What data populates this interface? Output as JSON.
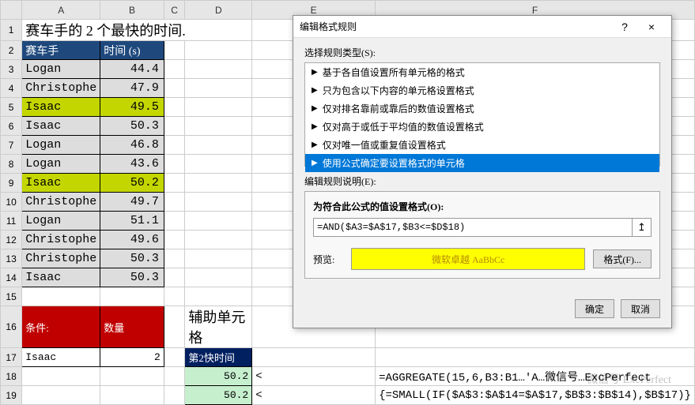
{
  "columns": [
    "A",
    "B",
    "C",
    "D",
    "E",
    "F"
  ],
  "row_count": 19,
  "title_row": "赛车手的 2 个最快的时间.",
  "headers": {
    "name": "赛车手",
    "time": "时间 (s)"
  },
  "data_rows": [
    {
      "name": "Logan",
      "time": "44.4",
      "hl": false
    },
    {
      "name": "Christophe",
      "time": "47.9",
      "hl": false
    },
    {
      "name": "Isaac",
      "time": "49.5",
      "hl": true
    },
    {
      "name": "Isaac",
      "time": "50.3",
      "hl": false
    },
    {
      "name": "Logan",
      "time": "46.8",
      "hl": false
    },
    {
      "name": "Logan",
      "time": "43.6",
      "hl": false
    },
    {
      "name": "Isaac",
      "time": "50.2",
      "hl": true
    },
    {
      "name": "Christophe",
      "time": "49.7",
      "hl": false
    },
    {
      "name": "Logan",
      "time": "51.1",
      "hl": false
    },
    {
      "name": "Christophe",
      "time": "49.6",
      "hl": false
    },
    {
      "name": "Christophe",
      "time": "50.3",
      "hl": false
    },
    {
      "name": "Isaac",
      "time": "50.3",
      "hl": false
    }
  ],
  "cond": {
    "label": "条件:",
    "qty_label": "数量",
    "name": "Isaac",
    "qty": "2"
  },
  "aux": {
    "title": "辅助单元格",
    "header": "第2快时间",
    "v1": "50.2",
    "v2": "50.2"
  },
  "formula_prefix": "<",
  "formula1": "=AGGREGATE(15,6,B3:B1…'A…微信号…ExcPerfect",
  "formula2": "{=SMALL(IF($A$3:$A$14=$A$17,$B$3:$B$14),$B$17)}",
  "dialog": {
    "title": "编辑格式规则",
    "help": "?",
    "close": "×",
    "select_label": "选择规则类型(S):",
    "rules": [
      "基于各自值设置所有单元格的格式",
      "只为包含以下内容的单元格设置格式",
      "仅对排名靠前或靠后的数值设置格式",
      "仅对高于或低于平均值的数值设置格式",
      "仅对唯一值或重复值设置格式",
      "使用公式确定要设置格式的单元格"
    ],
    "selected_rule_index": 5,
    "edit_label": "编辑规则说明(E):",
    "formula_label": "为符合此公式的值设置格式(O):",
    "formula_value": "=AND($A3=$A$17,$B3<=$D$18)",
    "preview_label": "预览:",
    "preview_text": "微软卓越 AaBbCc",
    "format_btn": "格式(F)...",
    "ok": "确定",
    "cancel": "取消"
  },
  "watermark_text": "微信号 ExcPerfect"
}
